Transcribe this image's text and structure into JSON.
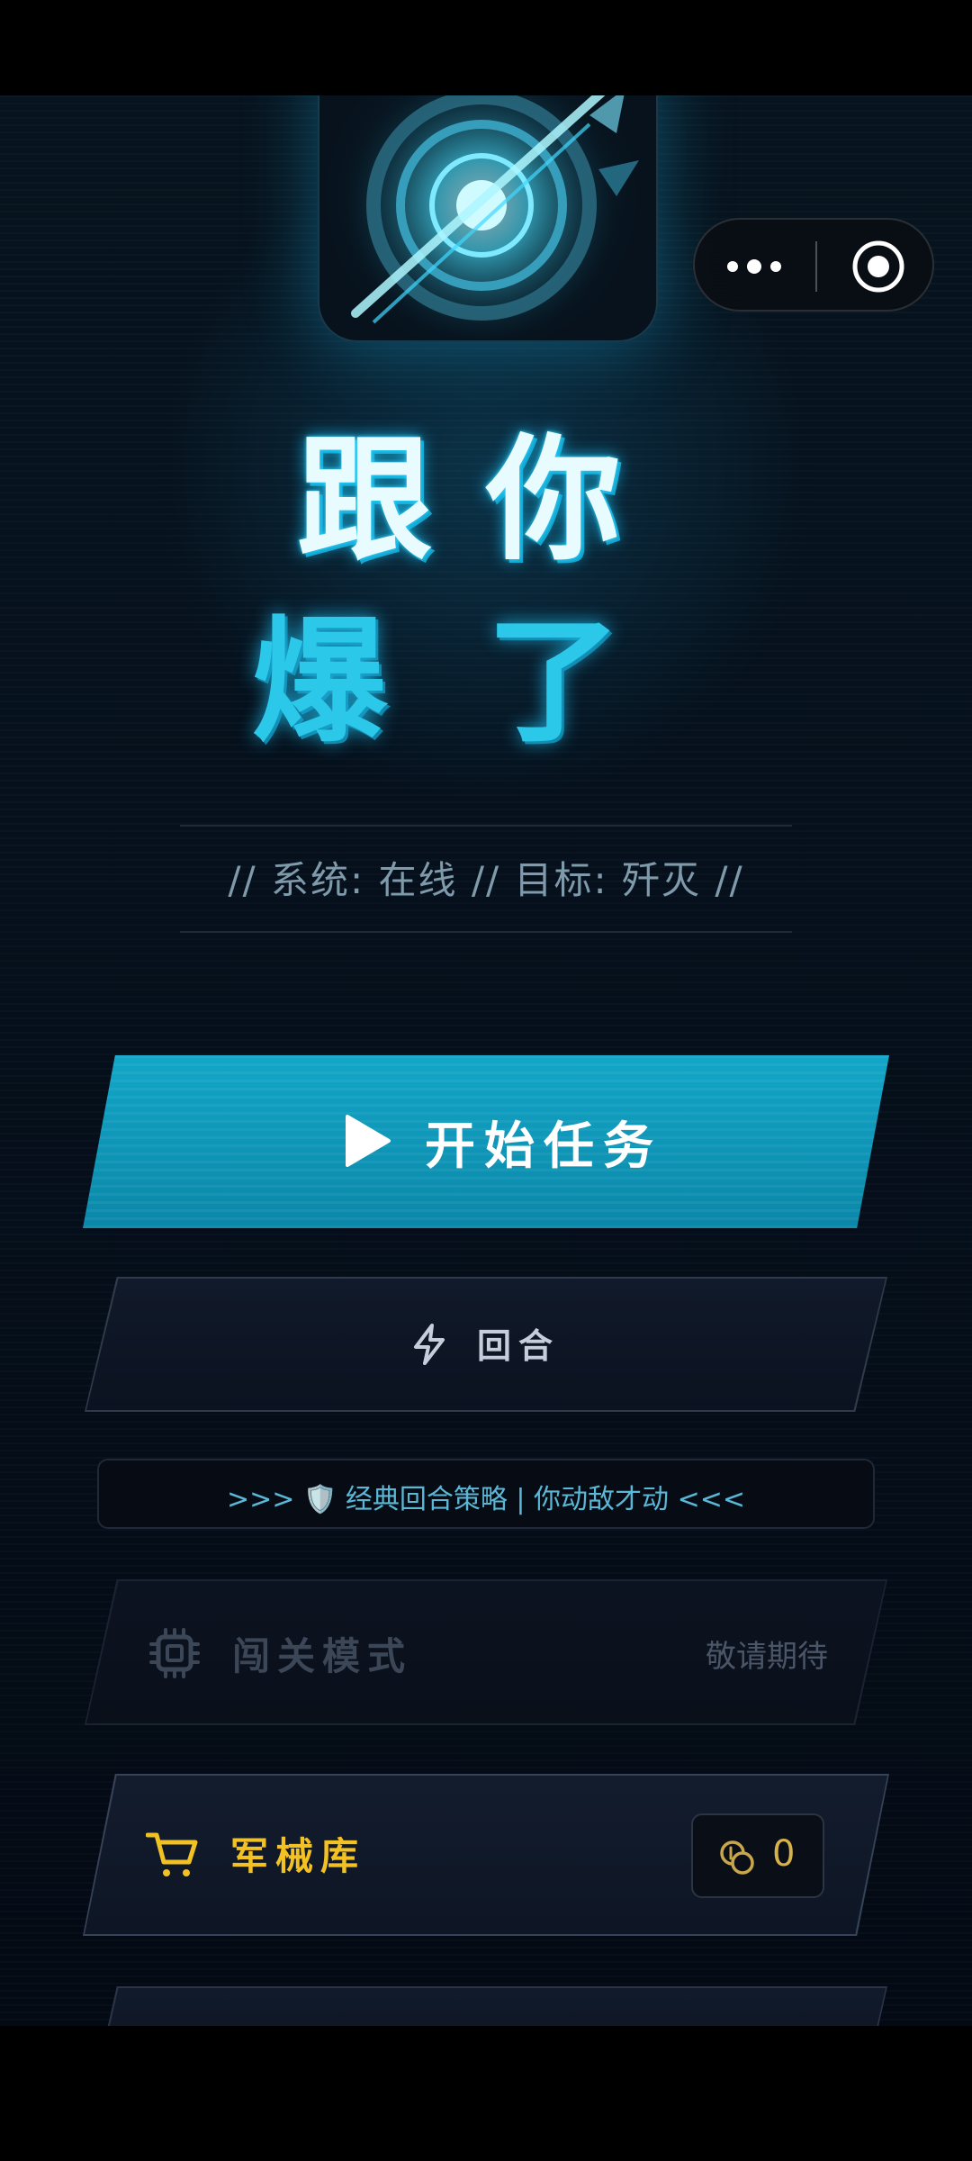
{
  "title": {
    "line1": "跟你",
    "line2": "爆了"
  },
  "status": {
    "text": "// 系统: 在线 // 目标: 歼灭 //"
  },
  "buttons": {
    "start_label": "开始任务",
    "round_label": "回合",
    "level_label": "闯关模式",
    "level_badge": "敬请期待",
    "armory_label": "军械库",
    "coins": "0"
  },
  "info": {
    "text": ">>> 🛡️ 经典回合策略 | 你动敌才动 <<<"
  },
  "colors": {
    "accent": "#12a6c8",
    "armory": "#f2c124",
    "info": "#5ab8d6"
  },
  "icons": {
    "capsule_more": "more-dots-icon",
    "capsule_close": "target-circle-icon",
    "start": "play-icon",
    "round": "lightning-icon",
    "level": "chip-icon",
    "armory": "cart-icon",
    "coins": "coins-icon"
  }
}
